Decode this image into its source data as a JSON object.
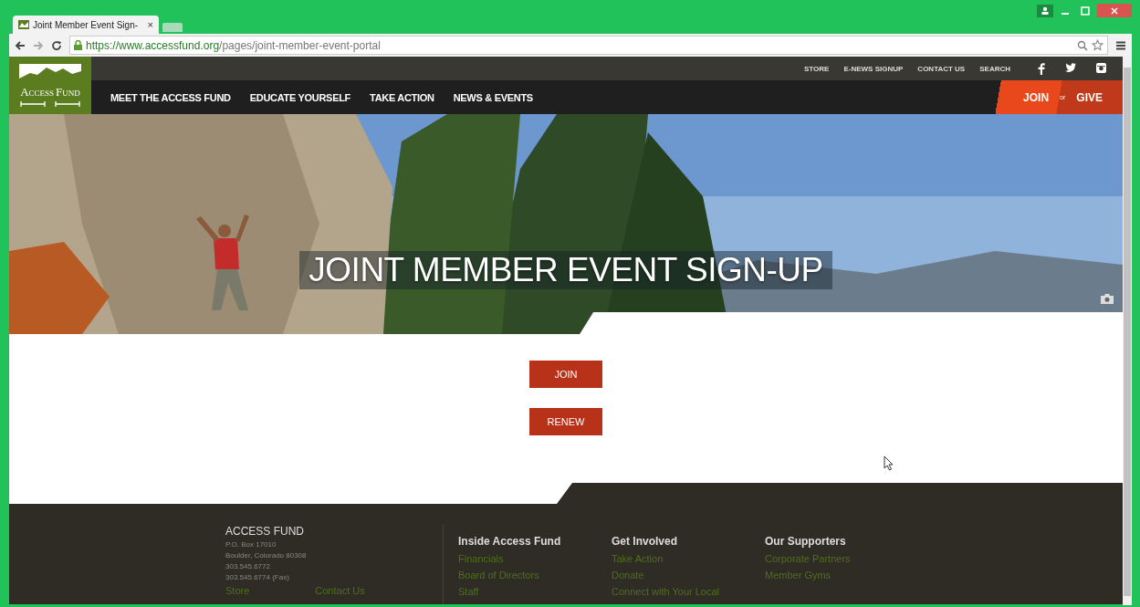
{
  "window": {
    "tab_title": "Joint Member Event Sign-",
    "tab_close": "×"
  },
  "address": {
    "secure_part": "https://www.accessfund.org",
    "path": "/pages/joint-member-event-portal"
  },
  "logo": {
    "word1": "Access",
    "word2": "Fund"
  },
  "utility_links": [
    "STORE",
    "E-NEWS SIGNUP",
    "CONTACT US",
    "SEARCH"
  ],
  "nav": [
    "MEET THE ACCESS FUND",
    "EDUCATE YOURSELF",
    "TAKE ACTION",
    "NEWS & EVENTS"
  ],
  "cta": {
    "join": "JOIN",
    "or": "or",
    "give": "GIVE"
  },
  "hero": {
    "title": "JOINT MEMBER EVENT SIGN-UP"
  },
  "buttons": [
    "JOIN",
    "RENEW"
  ],
  "footer": {
    "org": {
      "name": "ACCESS FUND",
      "lines": [
        "P.O. Box 17010",
        "Boulder, Colorado 80308",
        "303.545.6772",
        "303.545.6774 (Fax)"
      ],
      "links": [
        "Store",
        "Contact Us"
      ]
    },
    "columns": [
      {
        "heading": "Inside Access Fund",
        "links": [
          "Financials",
          "Board of Directors",
          "Staff"
        ]
      },
      {
        "heading": "Get Involved",
        "links": [
          "Take Action",
          "Donate",
          "Connect with Your Local"
        ]
      },
      {
        "heading": "Our Supporters",
        "links": [
          "Corporate Partners",
          "Member Gyms"
        ]
      }
    ]
  }
}
